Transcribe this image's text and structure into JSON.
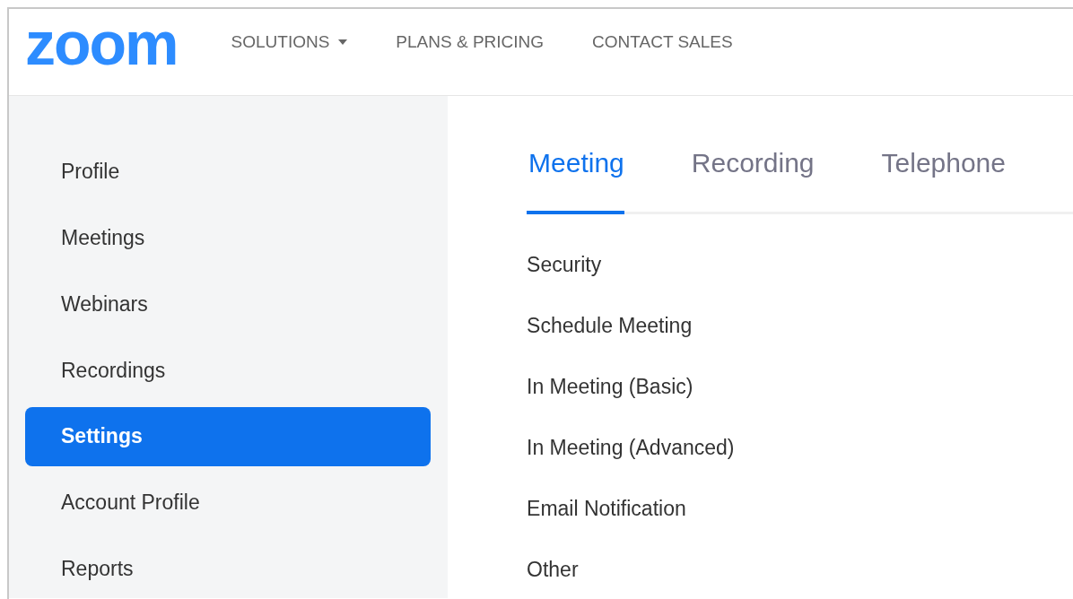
{
  "header": {
    "logo": "zoom",
    "nav": [
      {
        "label": "SOLUTIONS",
        "dropdown": true
      },
      {
        "label": "PLANS & PRICING",
        "dropdown": false
      },
      {
        "label": "CONTACT SALES",
        "dropdown": false
      }
    ]
  },
  "sidebar": {
    "items": [
      {
        "label": "Profile",
        "selected": false
      },
      {
        "label": "Meetings",
        "selected": false
      },
      {
        "label": "Webinars",
        "selected": false
      },
      {
        "label": "Recordings",
        "selected": false
      },
      {
        "label": "Settings",
        "selected": true
      },
      {
        "label": "Account Profile",
        "selected": false
      },
      {
        "label": "Reports",
        "selected": false
      }
    ]
  },
  "tabs": [
    {
      "label": "Meeting",
      "selected": true
    },
    {
      "label": "Recording",
      "selected": false
    },
    {
      "label": "Telephone",
      "selected": false
    }
  ],
  "sections": [
    "Security",
    "Schedule Meeting",
    "In Meeting (Basic)",
    "In Meeting (Advanced)",
    "Email Notification",
    "Other"
  ]
}
